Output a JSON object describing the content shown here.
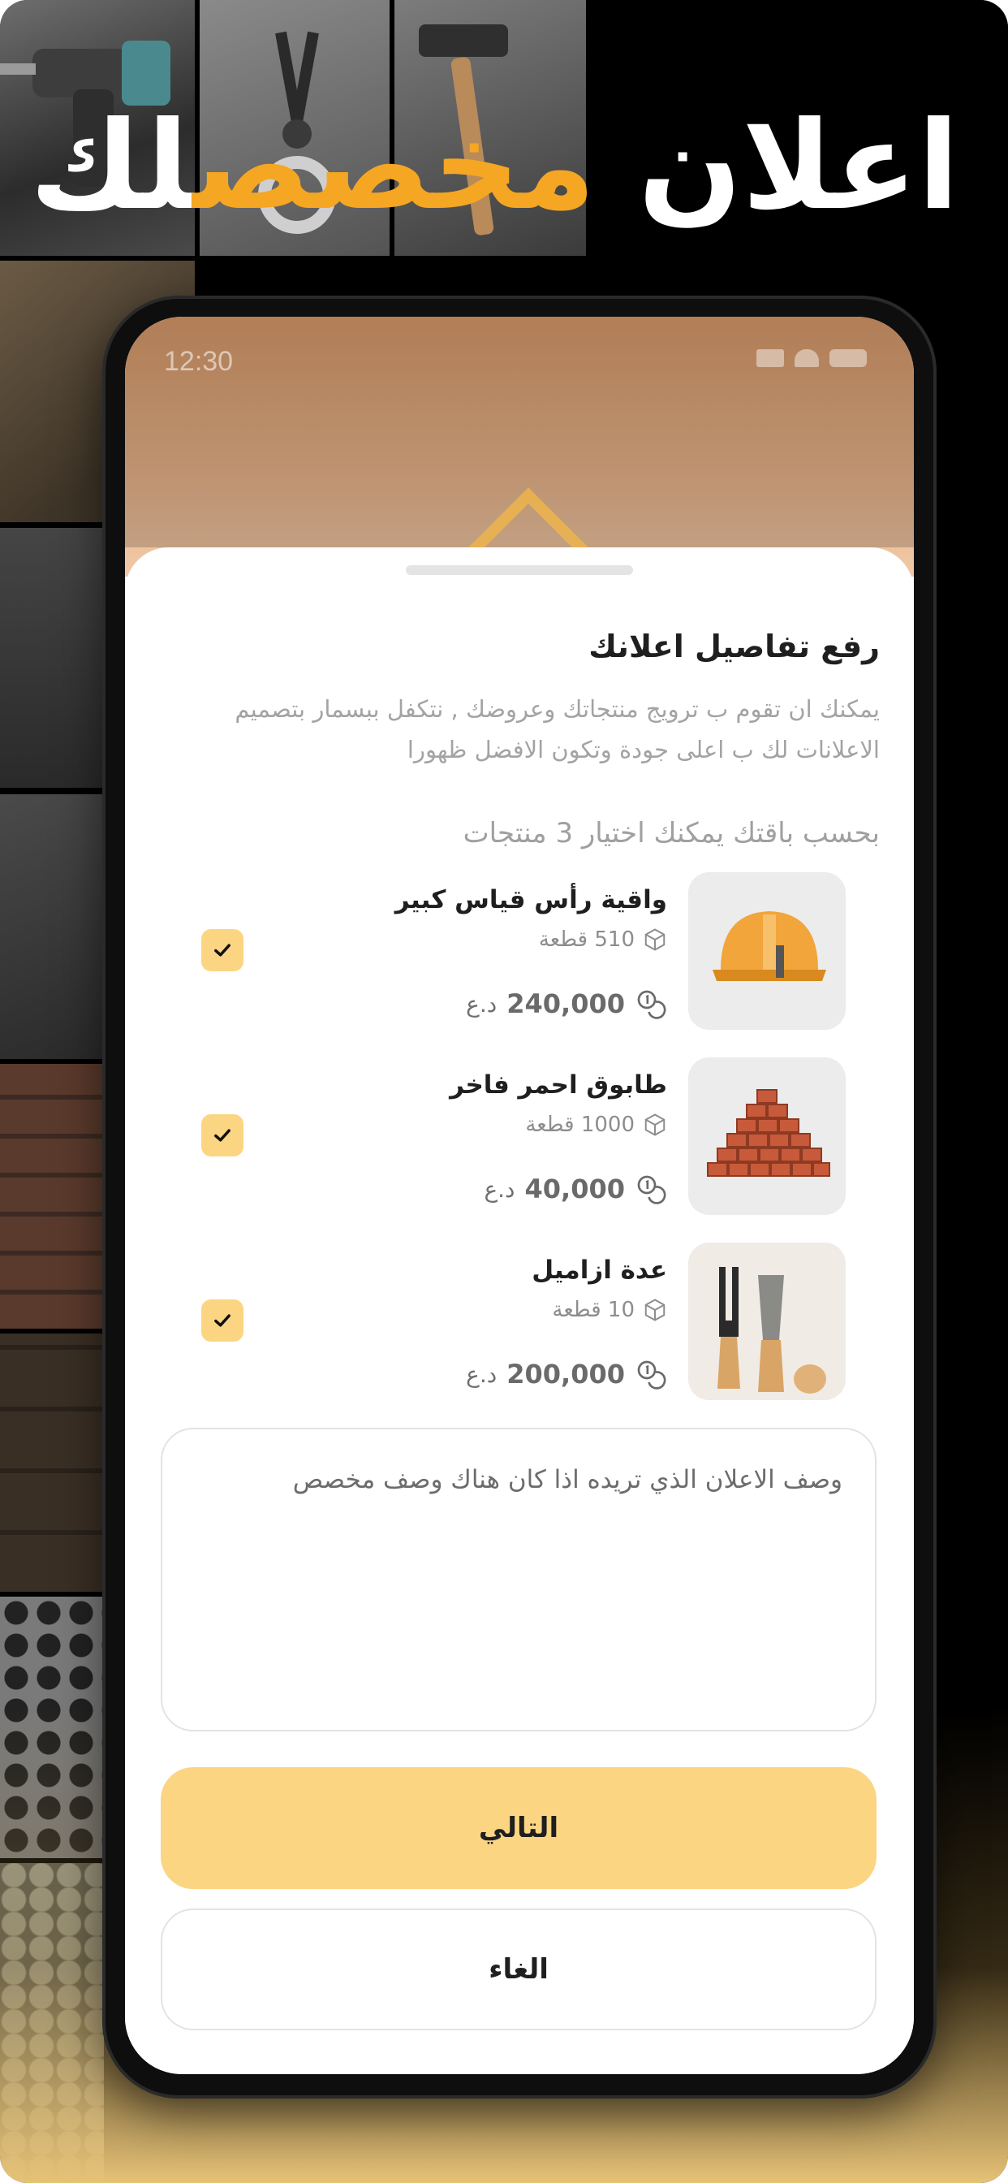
{
  "headline": {
    "word1": "اعلان",
    "word2": "مخصص",
    "word3": "لك"
  },
  "status_bar": {
    "time": "12:30"
  },
  "sheet": {
    "title": "رفع تفاصيل اعلانك",
    "description": "يمكنك ان تقوم ب ترويج منتجاتك وعروضك , نتكفل ببسمار بتصميم الاعلانات لك ب اعلى جودة وتكون الافضل ظهورا",
    "package_note": "بحسب باقتك يمكنك اختيار 3 منتجات"
  },
  "products": [
    {
      "name": "واقية رأس قياس كبير",
      "quantity": "510 قطعة",
      "price": "240,000",
      "currency": "د.ع",
      "checked": true,
      "image": "hard-hat"
    },
    {
      "name": "طابوق احمر فاخر",
      "quantity": "1000 قطعة",
      "price": "40,000",
      "currency": "د.ع",
      "checked": true,
      "image": "red-bricks"
    },
    {
      "name": "عدة ازاميل",
      "quantity": "10 قطعة",
      "price": "200,000",
      "currency": "د.ع",
      "checked": true,
      "image": "chisels"
    }
  ],
  "ad_description": {
    "placeholder": "وصف الاعلان الذي تريده اذا كان هناك وصف مخصص"
  },
  "buttons": {
    "next": "التالي",
    "cancel": "الغاء"
  },
  "colors": {
    "accent": "#f5a623",
    "button_primary": "#fcd583",
    "checkbox": "#fcd583"
  }
}
